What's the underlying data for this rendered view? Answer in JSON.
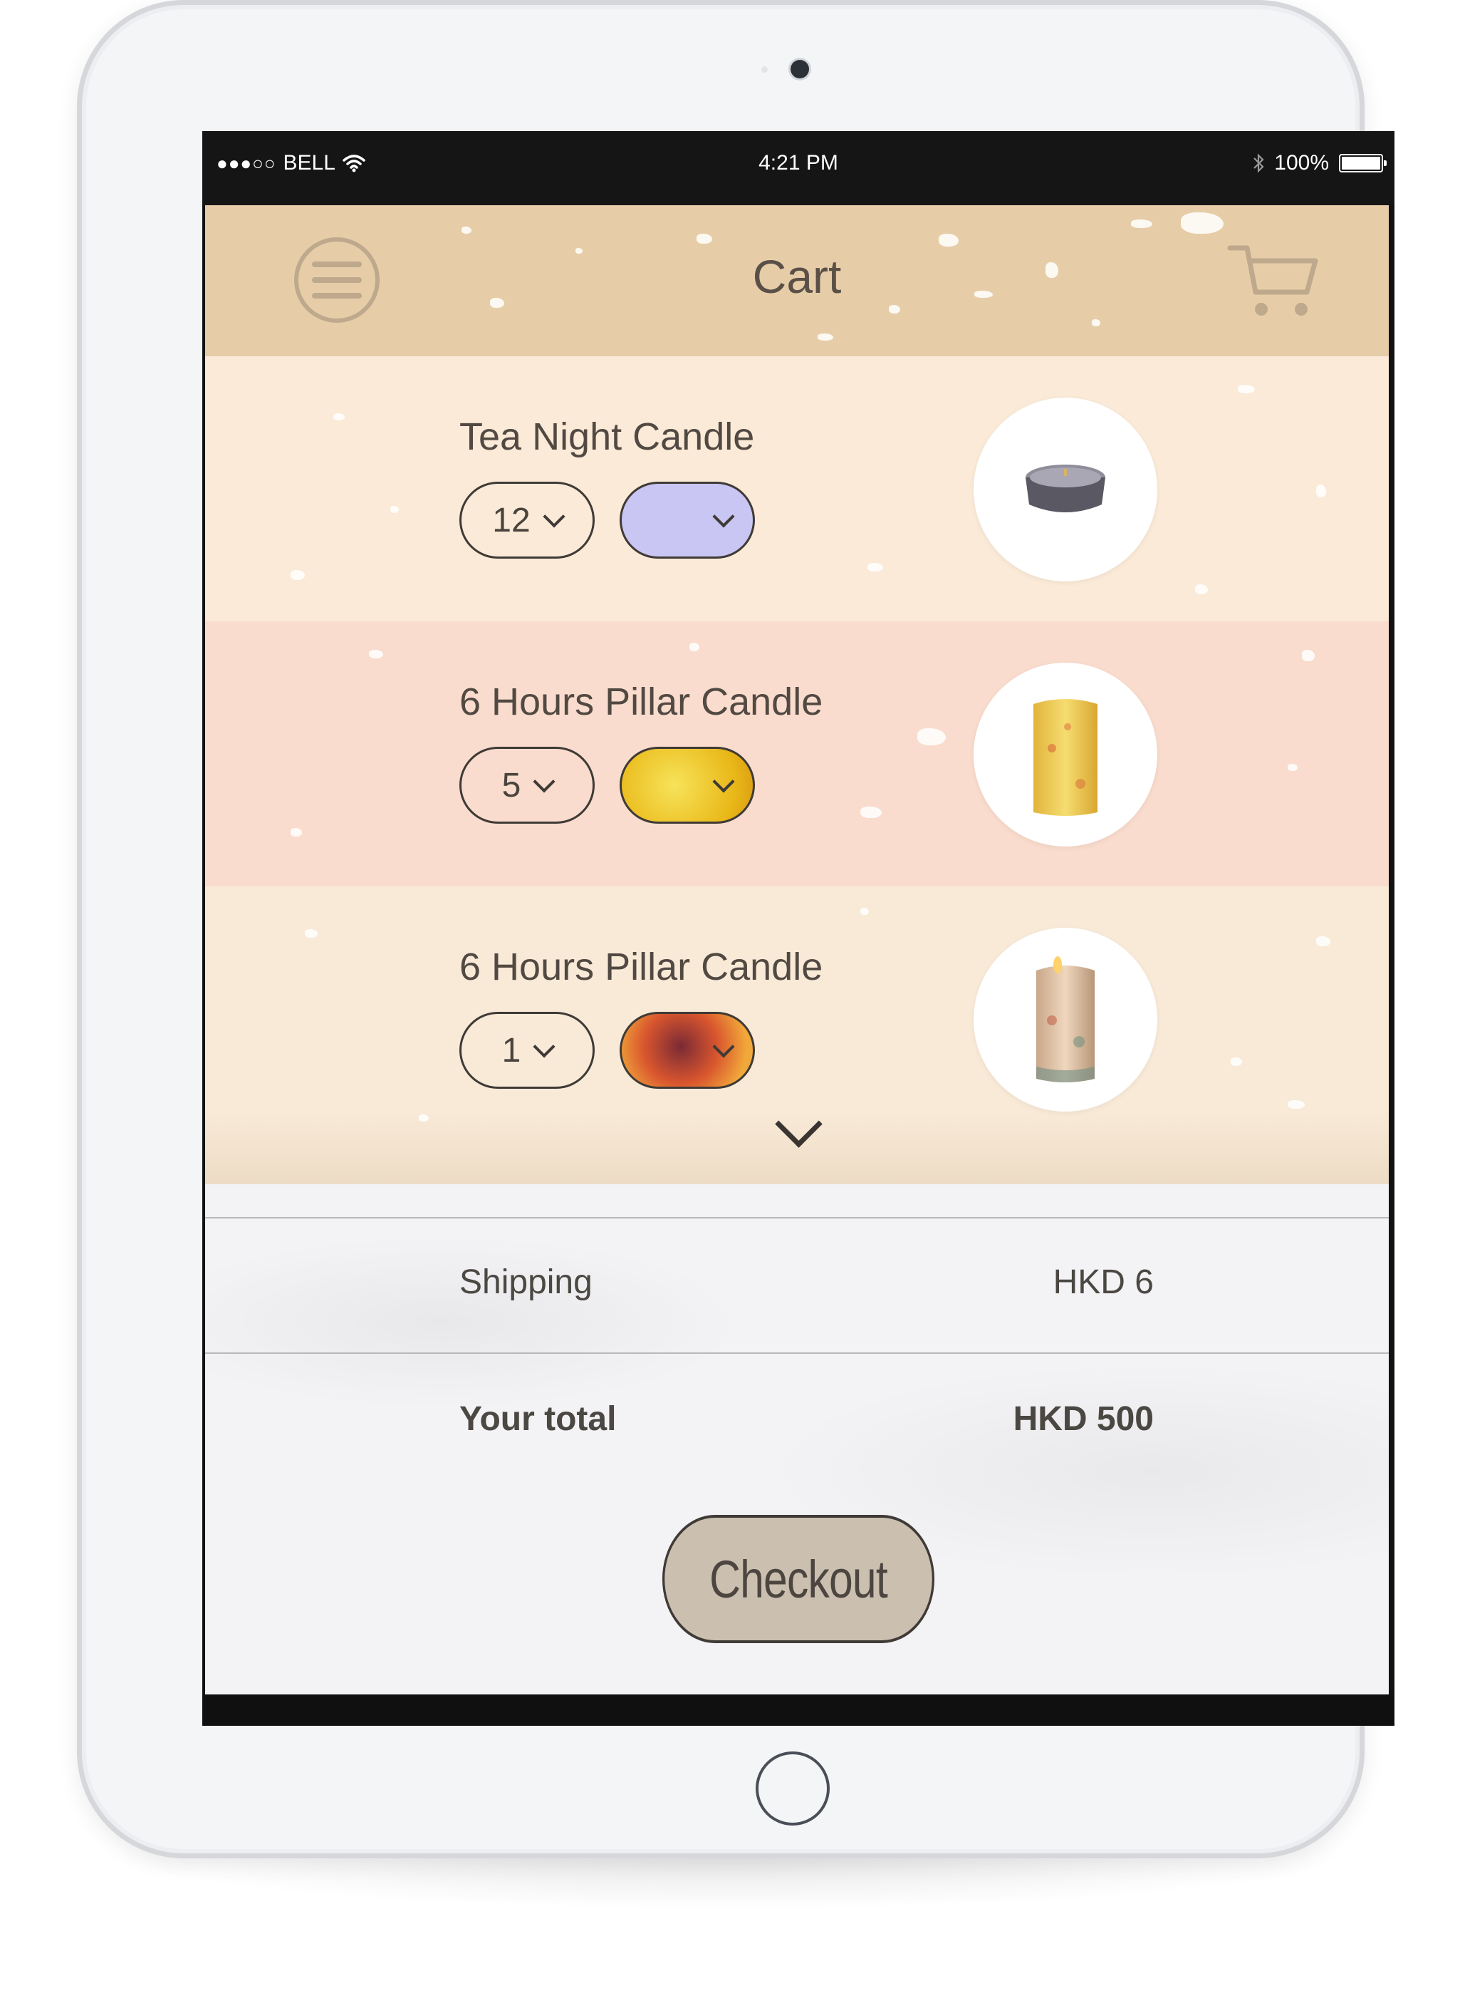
{
  "status_bar": {
    "signal": "●●●○○",
    "carrier": "BELL",
    "time": "4:21 PM",
    "battery": "100%"
  },
  "header": {
    "title": "Cart"
  },
  "cart": {
    "items": [
      {
        "name": "Tea Night Candle",
        "quantity": "12",
        "color": "#c9c6f3",
        "image": "tea-light-candle"
      },
      {
        "name": "6 Hours Pillar Candle",
        "quantity": "5",
        "color": "#f2cc2e",
        "image": "yellow-pillar-candle"
      },
      {
        "name": "6 Hours Pillar Candle",
        "quantity": "1",
        "color": "#d9562e",
        "image": "multicolor-pillar-candle"
      }
    ]
  },
  "summary": {
    "shipping_label": "Shipping",
    "shipping_value": "HKD 6",
    "total_label": "Your total",
    "total_value": "HKD 500"
  },
  "checkout": {
    "label": "Checkout"
  },
  "colors": {
    "header_bg": "#e6cda8",
    "row1_bg": "#faead7",
    "row2_bg": "#f9dccd",
    "row3_bg": "#f9ead8",
    "checkout_bg": "#cbbfb0"
  }
}
